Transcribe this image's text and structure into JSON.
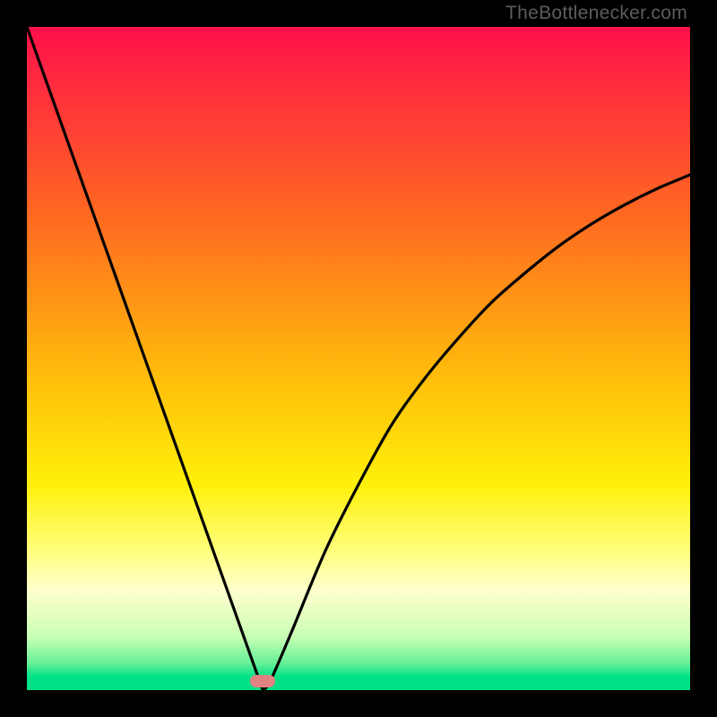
{
  "watermark": "TheBottlenecker.com",
  "chart_data": {
    "type": "line",
    "title": "",
    "xlabel": "",
    "ylabel": "",
    "xlim": [
      0,
      100
    ],
    "ylim": [
      0,
      100
    ],
    "x": [
      0,
      5,
      10,
      15,
      20,
      25,
      30,
      33,
      35,
      36,
      37,
      40,
      45,
      50,
      55,
      60,
      65,
      70,
      75,
      80,
      85,
      90,
      95,
      100
    ],
    "values": [
      100,
      85.5,
      70.9,
      56.4,
      41.8,
      27.3,
      12.7,
      4,
      2,
      0.3,
      2,
      9,
      21,
      31,
      40,
      47,
      53,
      58.4,
      62.8,
      66.8,
      70.2,
      73.1,
      75.6,
      77.7
    ],
    "minimum": {
      "x": 35.5,
      "y": 0.2
    },
    "gradient_stops": [
      {
        "pos": 0.0,
        "color": "rgb(255,16,75)"
      },
      {
        "pos": 0.27,
        "color": "rgb(255,100,35)"
      },
      {
        "pos": 0.53,
        "color": "rgb(255,190,10)"
      },
      {
        "pos": 0.69,
        "color": "rgb(255,240,10)"
      },
      {
        "pos": 0.79,
        "color": "rgb(255,255,125)"
      },
      {
        "pos": 0.85,
        "color": "rgb(255,255,205)"
      },
      {
        "pos": 0.92,
        "color": "rgb(200,255,180)"
      },
      {
        "pos": 0.96,
        "color": "rgb(100,240,150)"
      },
      {
        "pos": 0.98,
        "color": "rgb(0,225,135)"
      },
      {
        "pos": 1.0,
        "color": "rgb(0,225,135)"
      }
    ]
  },
  "marker": {
    "x_pct": 35.5,
    "y_pct": 1.3,
    "color": "rgb(225,130,130)"
  }
}
